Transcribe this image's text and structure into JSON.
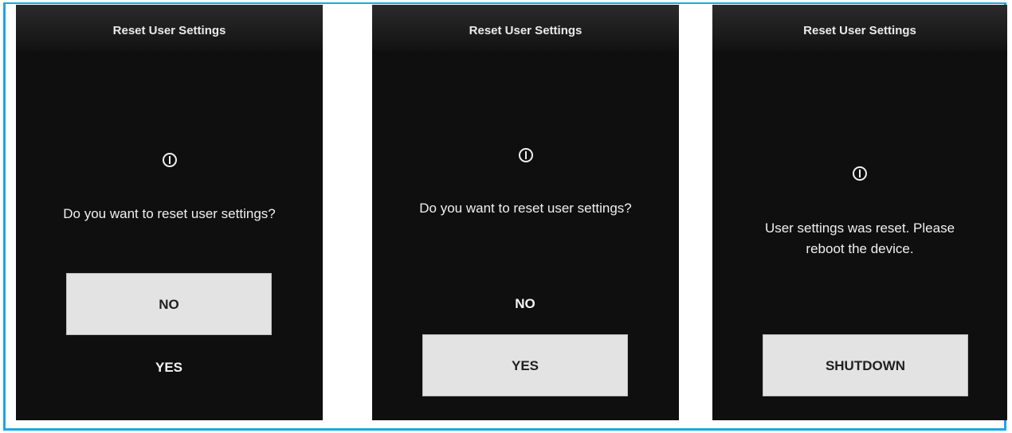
{
  "screens": [
    {
      "title": "Reset User Settings",
      "icon": "info-circle-icon",
      "message": "Do you want to reset user settings?",
      "buttons": {
        "no": "NO",
        "yes": "YES"
      },
      "focused": "no"
    },
    {
      "title": "Reset User Settings",
      "icon": "info-circle-icon",
      "message": "Do you want to reset user settings?",
      "buttons": {
        "no": "NO",
        "yes": "YES"
      },
      "focused": "yes"
    },
    {
      "title": "Reset User Settings",
      "icon": "info-circle-icon",
      "message_line1": "User settings was reset. Please",
      "message_line2": "reboot the device.",
      "buttons": {
        "shutdown": "SHUTDOWN"
      }
    }
  ],
  "colors": {
    "frame_border": "#1aa7e6",
    "screen_bg": "#0f0f0f",
    "button_bg": "#e3e3e3",
    "button_text": "#202020",
    "text": "#f0f0f0"
  }
}
